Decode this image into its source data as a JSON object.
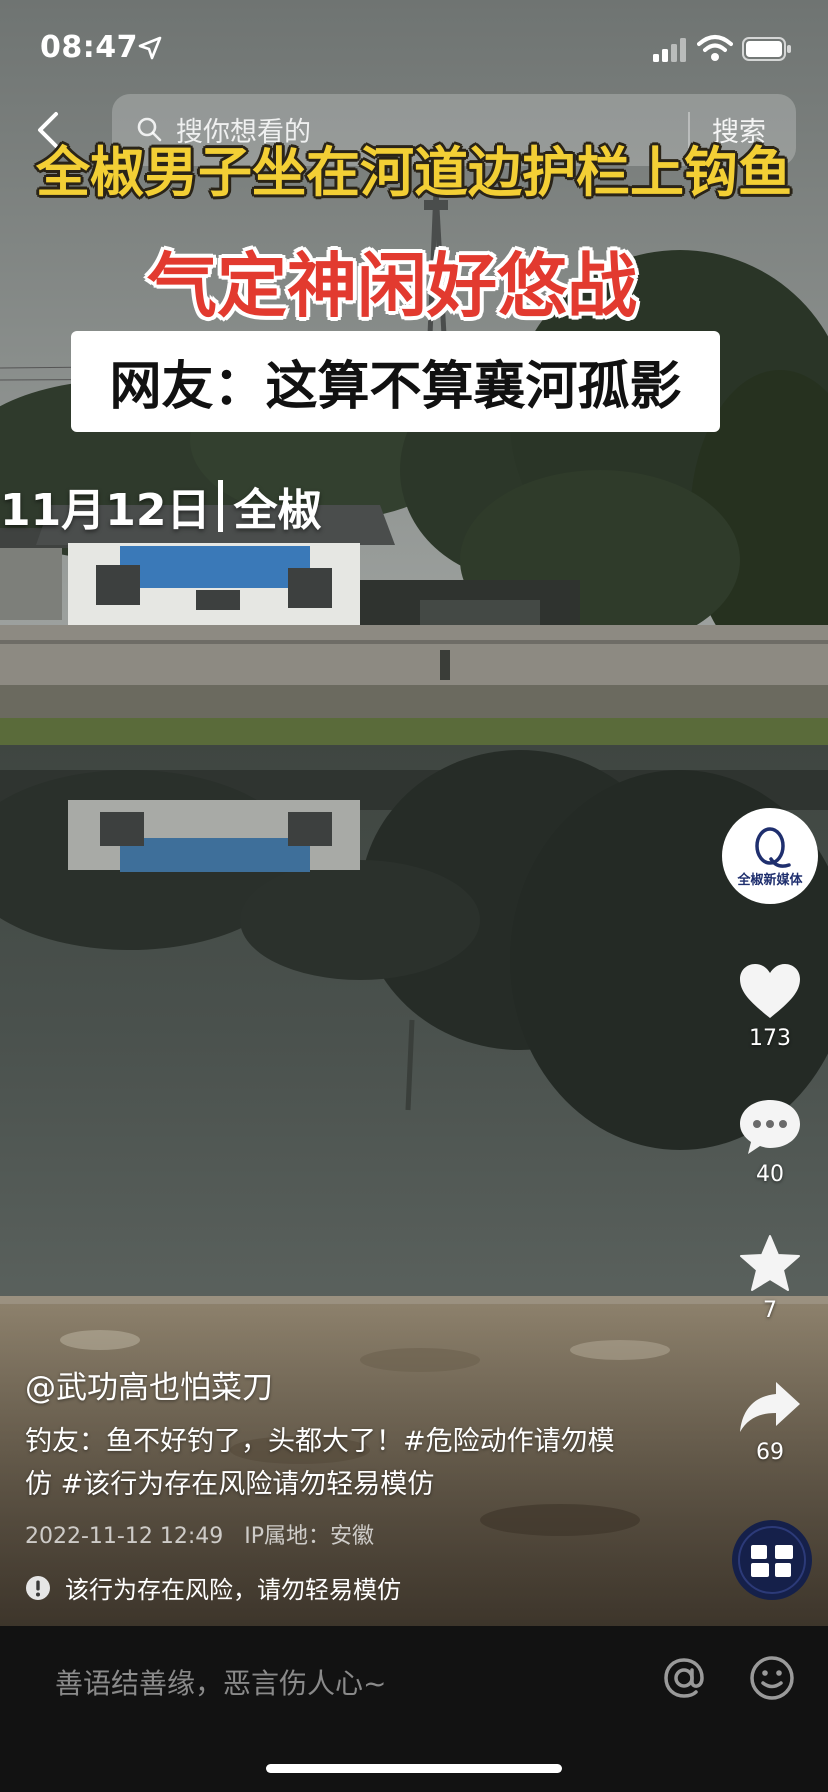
{
  "status_bar": {
    "time": "08:47"
  },
  "search": {
    "placeholder": "搜你想看的",
    "button": "搜索"
  },
  "video": {
    "caption_line1": "全椒男子坐在河道边护栏上钩鱼",
    "caption_line2": "气定神闲好悠战",
    "caption_line3": "网友：这算不算襄河孤影",
    "date": "11月12日",
    "location": "全椒"
  },
  "actions": {
    "avatar_label": "全椒新媒体",
    "likes": "173",
    "comments": "40",
    "favorites": "7",
    "shares": "69"
  },
  "post": {
    "author": "@武功高也怕菜刀",
    "description": "钓友：鱼不好钓了，头都大了！#危险动作请勿模仿 #该行为存在风险请勿轻易模仿",
    "timestamp": "2022-11-12 12:49",
    "ip_location": "IP属地：安徽",
    "warning": "该行为存在风险，请勿轻易模仿"
  },
  "comment_bar": {
    "placeholder": "善语结善缘，恶言伤人心~"
  },
  "icons": [
    "location-arrow-icon",
    "signal-icon",
    "wifi-icon",
    "battery-icon",
    "back-chevron-icon",
    "search-icon",
    "heart-icon",
    "comment-icon",
    "star-icon",
    "share-icon",
    "warning-icon",
    "at-icon",
    "emoji-icon"
  ],
  "colors": {
    "caption_yellow": "#f3cf35",
    "caption_red": "#e23a2f",
    "comment_bar_bg": "#121212",
    "avatar_brand": "#1f2f6e"
  }
}
